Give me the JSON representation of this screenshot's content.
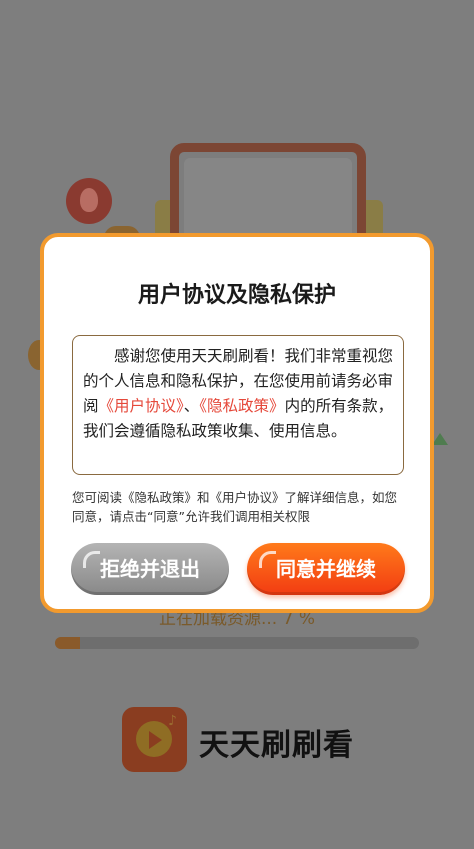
{
  "background": {
    "loading_text": "正在加载资源... 7 %",
    "progress_fraction": 0.07,
    "app_name": "天天刷刷看"
  },
  "dialog": {
    "title": "用户协议及隐私保护",
    "body_part1": "感谢您使用天天刷刷看！我们非常重视您的个人信息和隐私保护，在您使用前请务必审阅",
    "user_agreement_link": "《用户协议》",
    "separator": "、",
    "privacy_policy_link": "《隐私政策》",
    "body_part2": "内的所有条款，我们会遵循隐私政策收集、使用信息。",
    "note": "您可阅读《隐私政策》和《用户协议》了解详细信息，如您同意，请点击“同意”允许我们调用相关权限",
    "reject_label": "拒绝并退出",
    "agree_label": "同意并继续"
  },
  "colors": {
    "dialog_border": "#f29a2e",
    "link": "#e5483a",
    "agree_button": "#f23b12",
    "reject_button": "#9b9b9b"
  }
}
